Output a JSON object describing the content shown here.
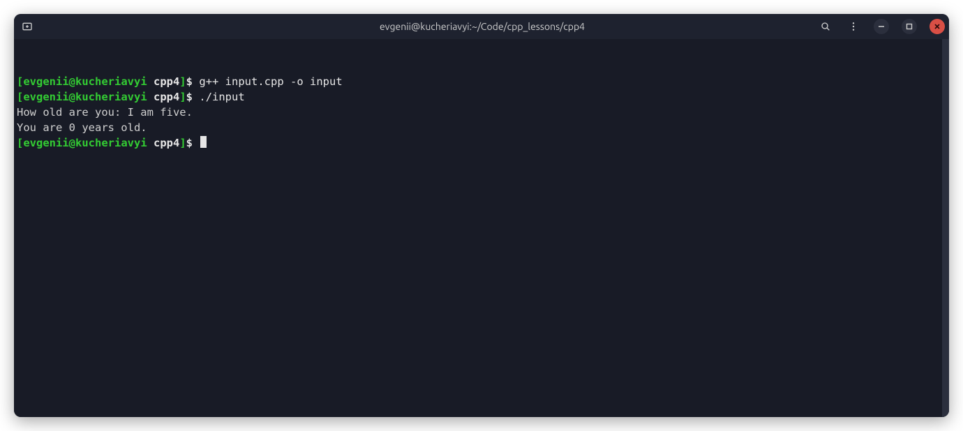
{
  "titlebar": {
    "title": "evgenii@kucheriavyi:~/Code/cpp_lessons/cpp4"
  },
  "prompt": {
    "open_bracket": "[",
    "user_host": "evgenii@kucheriavyi",
    "cwd": "cpp4",
    "close_bracket": "]",
    "symbol": "$"
  },
  "lines": [
    {
      "type": "cmd",
      "text": "g++ input.cpp -o input"
    },
    {
      "type": "cmd",
      "text": "./input"
    },
    {
      "type": "out",
      "text": "How old are you: I am five."
    },
    {
      "type": "out",
      "text": "You are 0 years old."
    },
    {
      "type": "cmd",
      "text": "",
      "cursor": true
    }
  ]
}
